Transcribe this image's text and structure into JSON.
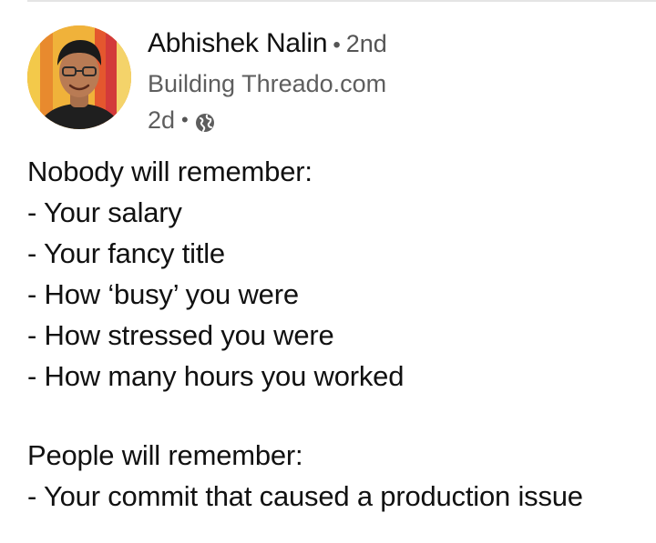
{
  "author": {
    "name": "Abhishek Nalin",
    "connection_degree": "2nd",
    "headline": "Building Threado.com",
    "separator": "•",
    "avatar_icon": "profile-photo"
  },
  "post_meta": {
    "time": "2d",
    "separator": "•",
    "visibility_icon": "globe-icon"
  },
  "post": {
    "section1": {
      "heading": "Nobody will remember:",
      "items": [
        "- Your salary",
        "- Your fancy title",
        "- How ‘busy’ you were",
        "- How stressed you were",
        "- How many hours you worked"
      ]
    },
    "section2": {
      "heading": "People will remember:",
      "items": [
        "- Your commit that caused a production issue"
      ]
    }
  },
  "colors": {
    "text_primary": "#111111",
    "text_secondary": "#5e5e5e",
    "divider": "#e4e4e4"
  }
}
